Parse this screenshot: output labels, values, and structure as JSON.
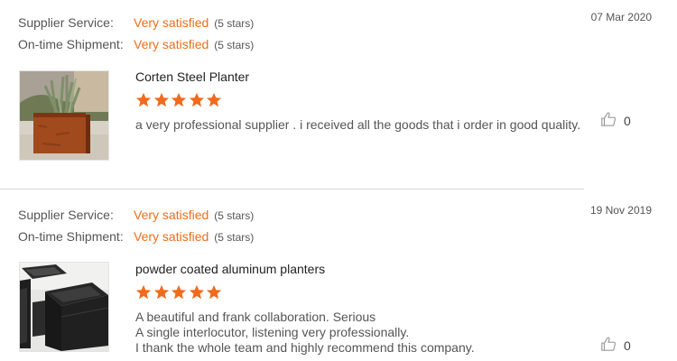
{
  "reviews": [
    {
      "supplier_service_label": "Supplier Service:",
      "supplier_service_value": "Very satisfied",
      "supplier_service_stars": "(5 stars)",
      "shipment_label": "On-time Shipment:",
      "shipment_value": "Very satisfied",
      "shipment_stars": "(5 stars)",
      "date": "07 Mar 2020",
      "product_name": "Corten Steel Planter",
      "rating": 5,
      "text_lines": [
        "a very professional supplier . i received all the goods that i order in good quality."
      ],
      "likes": "0"
    },
    {
      "supplier_service_label": "Supplier Service:",
      "supplier_service_value": "Very satisfied",
      "supplier_service_stars": "(5 stars)",
      "shipment_label": "On-time Shipment:",
      "shipment_value": "Very satisfied",
      "shipment_stars": "(5 stars)",
      "date": "19 Nov 2019",
      "product_name": "powder coated aluminum planters",
      "rating": 5,
      "text_lines": [
        "A beautiful and frank collaboration. Serious",
        "A single interlocutor, listening very professionally.",
        "I thank the whole team and highly recommend this company."
      ],
      "likes": "0"
    }
  ],
  "colors": {
    "accent": "#f06d1a",
    "star": "#f26a1b",
    "divider": "#d9d9d9"
  },
  "icons": {
    "like": "thumbs-up-icon",
    "star": "star-icon"
  }
}
